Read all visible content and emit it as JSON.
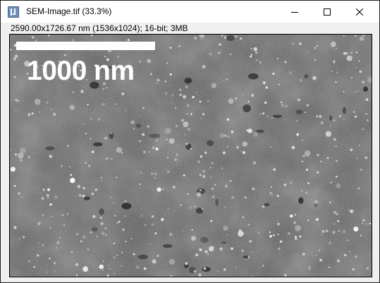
{
  "window": {
    "title": "SEM-Image.tif (33.3%)",
    "info": "2590.00x1726.67 nm (1536x1024); 16-bit; 3MB",
    "buttons": {
      "minimize_icon": "minimize-icon",
      "maximize_icon": "maximize-icon",
      "close_icon": "close-icon"
    }
  },
  "image": {
    "scale_label": "1000 nm",
    "scalebar_color": "#ffffff",
    "background_color": "#4f4f4f"
  }
}
